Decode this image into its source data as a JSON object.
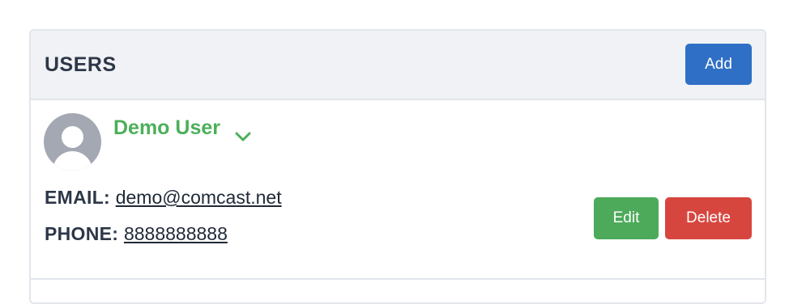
{
  "panel": {
    "title": "USERS",
    "add_label": "Add"
  },
  "users": [
    {
      "name": "Demo User",
      "email_label": "EMAIL:",
      "email": "demo@comcast.net",
      "phone_label": "PHONE:",
      "phone": "8888888888",
      "edit_label": "Edit",
      "delete_label": "Delete"
    }
  ],
  "icons": {
    "avatar": "user-avatar-icon",
    "expand": "chevron-down-icon"
  },
  "colors": {
    "primary": "#2f6fc6",
    "success": "#4caa5a",
    "danger": "#d6463f",
    "name_green": "#4caf5a",
    "header_bg": "#f0f2f5",
    "avatar_gray": "#a3a8b3"
  }
}
